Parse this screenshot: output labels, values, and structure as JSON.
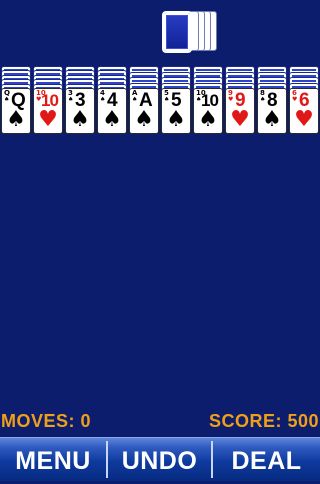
{
  "stock": {
    "card_count": 5
  },
  "tableau": [
    {
      "facedown": 5,
      "rank": "Q",
      "suit": "♠",
      "color": "black"
    },
    {
      "facedown": 5,
      "rank": "10",
      "suit": "♥",
      "color": "red"
    },
    {
      "facedown": 5,
      "rank": "3",
      "suit": "♠",
      "color": "black"
    },
    {
      "facedown": 5,
      "rank": "4",
      "suit": "♠",
      "color": "black"
    },
    {
      "facedown": 4,
      "rank": "A",
      "suit": "♠",
      "color": "black"
    },
    {
      "facedown": 4,
      "rank": "5",
      "suit": "♠",
      "color": "black"
    },
    {
      "facedown": 4,
      "rank": "10",
      "suit": "♠",
      "color": "black"
    },
    {
      "facedown": 4,
      "rank": "9",
      "suit": "♥",
      "color": "red"
    },
    {
      "facedown": 4,
      "rank": "8",
      "suit": "♠",
      "color": "black"
    },
    {
      "facedown": 4,
      "rank": "6",
      "suit": "♥",
      "color": "red"
    }
  ],
  "status": {
    "moves_text": "MOVES: 0",
    "score_text": "SCORE: 500"
  },
  "toolbar": {
    "menu_label": "MENU",
    "undo_label": "UNDO",
    "deal_label": "DEAL"
  },
  "colors": {
    "background": "#0c1d6e",
    "status_text": "#f0a018",
    "card_red": "#e11818",
    "card_black": "#000000"
  }
}
